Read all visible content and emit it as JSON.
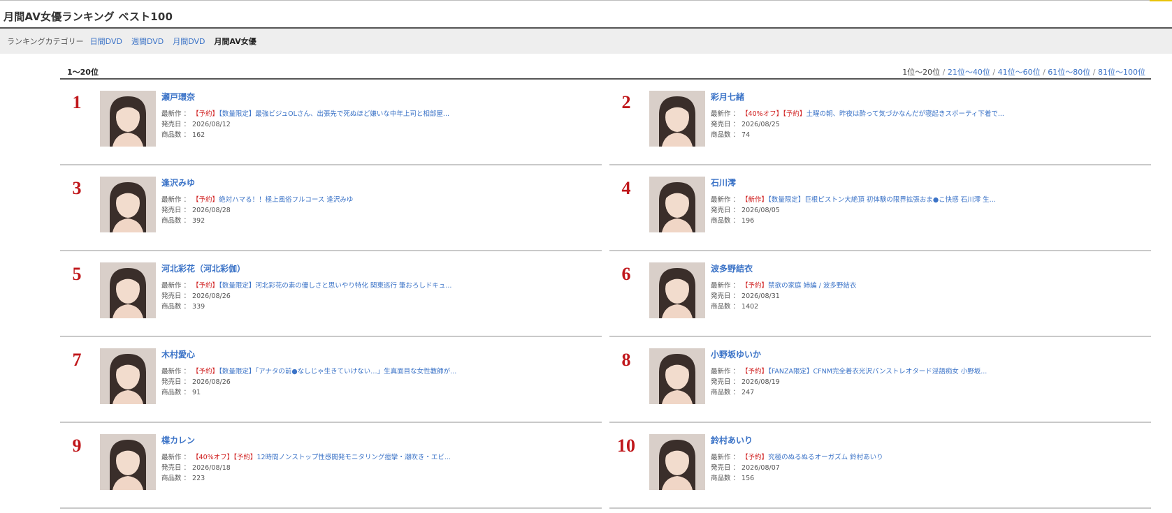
{
  "page": {
    "title": "月間AV女優ランキング ベスト100"
  },
  "categories": {
    "label": "ランキングカテゴリー",
    "links": [
      "日間DVD",
      "週間DVD",
      "月間DVD"
    ],
    "current": "月間AV女優"
  },
  "range": {
    "current": "1〜20位",
    "nav_current": "1位〜20位",
    "separator": " / ",
    "nav_links": [
      "21位〜40位",
      "41位〜60位",
      "61位〜80位",
      "81位〜100位"
    ]
  },
  "labels": {
    "latest": "最新作 ： ",
    "release": "発売日 ： ",
    "count": "商品数 ： "
  },
  "colors": {
    "link": "#3b73c7",
    "rank": "#c0171b",
    "tag": "#d02020"
  },
  "entries": [
    {
      "rank": "1",
      "name": "瀬戸環奈",
      "tags": [
        "【予約】"
      ],
      "tags2": [
        "【数量限定】"
      ],
      "latest": "最強ビジュOLさん、出張先で死ぬほど嫌いな中年上司と相部屋...",
      "release": "2026/08/12",
      "count": "162"
    },
    {
      "rank": "2",
      "name": "彩月七緒",
      "tags": [
        "【40%オフ】",
        "【予約】"
      ],
      "tags2": [],
      "latest": "土曜の朝、昨夜は酔って気づかなんだが寝起きスポーティ下着で...",
      "release": "2026/08/25",
      "count": "74"
    },
    {
      "rank": "3",
      "name": "逢沢みゆ",
      "tags": [
        "【予約】"
      ],
      "tags2": [],
      "latest": "絶対ハマる！！極上風俗フルコース 逢沢みゆ",
      "release": "2026/08/28",
      "count": "392"
    },
    {
      "rank": "4",
      "name": "石川澪",
      "tags": [
        "【新作】"
      ],
      "tags2": [
        "【数量限定】"
      ],
      "latest": "巨根ピストン大絶頂 初体験の限界拡張おま●こ快感 石川澪 生...",
      "release": "2026/08/05",
      "count": "196"
    },
    {
      "rank": "5",
      "name": "河北彩花（河北彩伽）",
      "tags": [
        "【予約】"
      ],
      "tags2": [
        "【数量限定】"
      ],
      "latest": "河北彩花の素の優しさと思いやり特化 関東巡行 筆おろしドキュ...",
      "release": "2026/08/26",
      "count": "339"
    },
    {
      "rank": "6",
      "name": "波多野結衣",
      "tags": [
        "【予約】"
      ],
      "tags2": [],
      "latest": "禁欲の家庭 姉編 / 波多野結衣",
      "release": "2026/08/31",
      "count": "1402"
    },
    {
      "rank": "7",
      "name": "木村愛心",
      "tags": [
        "【予約】"
      ],
      "tags2": [
        "【数量限定】"
      ],
      "latest": "「アナタの前●なしじゃ生きていけない…」生真面目な女性教師が...",
      "release": "2026/08/26",
      "count": "91"
    },
    {
      "rank": "8",
      "name": "小野坂ゆいか",
      "tags": [
        "【予約】"
      ],
      "tags2": [
        "【FANZA限定】"
      ],
      "latest": "CFNM完全着衣光沢パンストレオタード淫語痴女 小野坂...",
      "release": "2026/08/19",
      "count": "247"
    },
    {
      "rank": "9",
      "name": "楪カレン",
      "tags": [
        "【40%オフ】",
        "【予約】"
      ],
      "tags2": [],
      "latest": "12時間ノンストップ性感開発モニタリング痙攣・潮吹き・エビ...",
      "release": "2026/08/18",
      "count": "223"
    },
    {
      "rank": "10",
      "name": "鈴村あいり",
      "tags": [
        "【予約】"
      ],
      "tags2": [],
      "latest": "究極のぬるぬるオーガズム 鈴村あいり",
      "release": "2026/08/07",
      "count": "156"
    }
  ]
}
